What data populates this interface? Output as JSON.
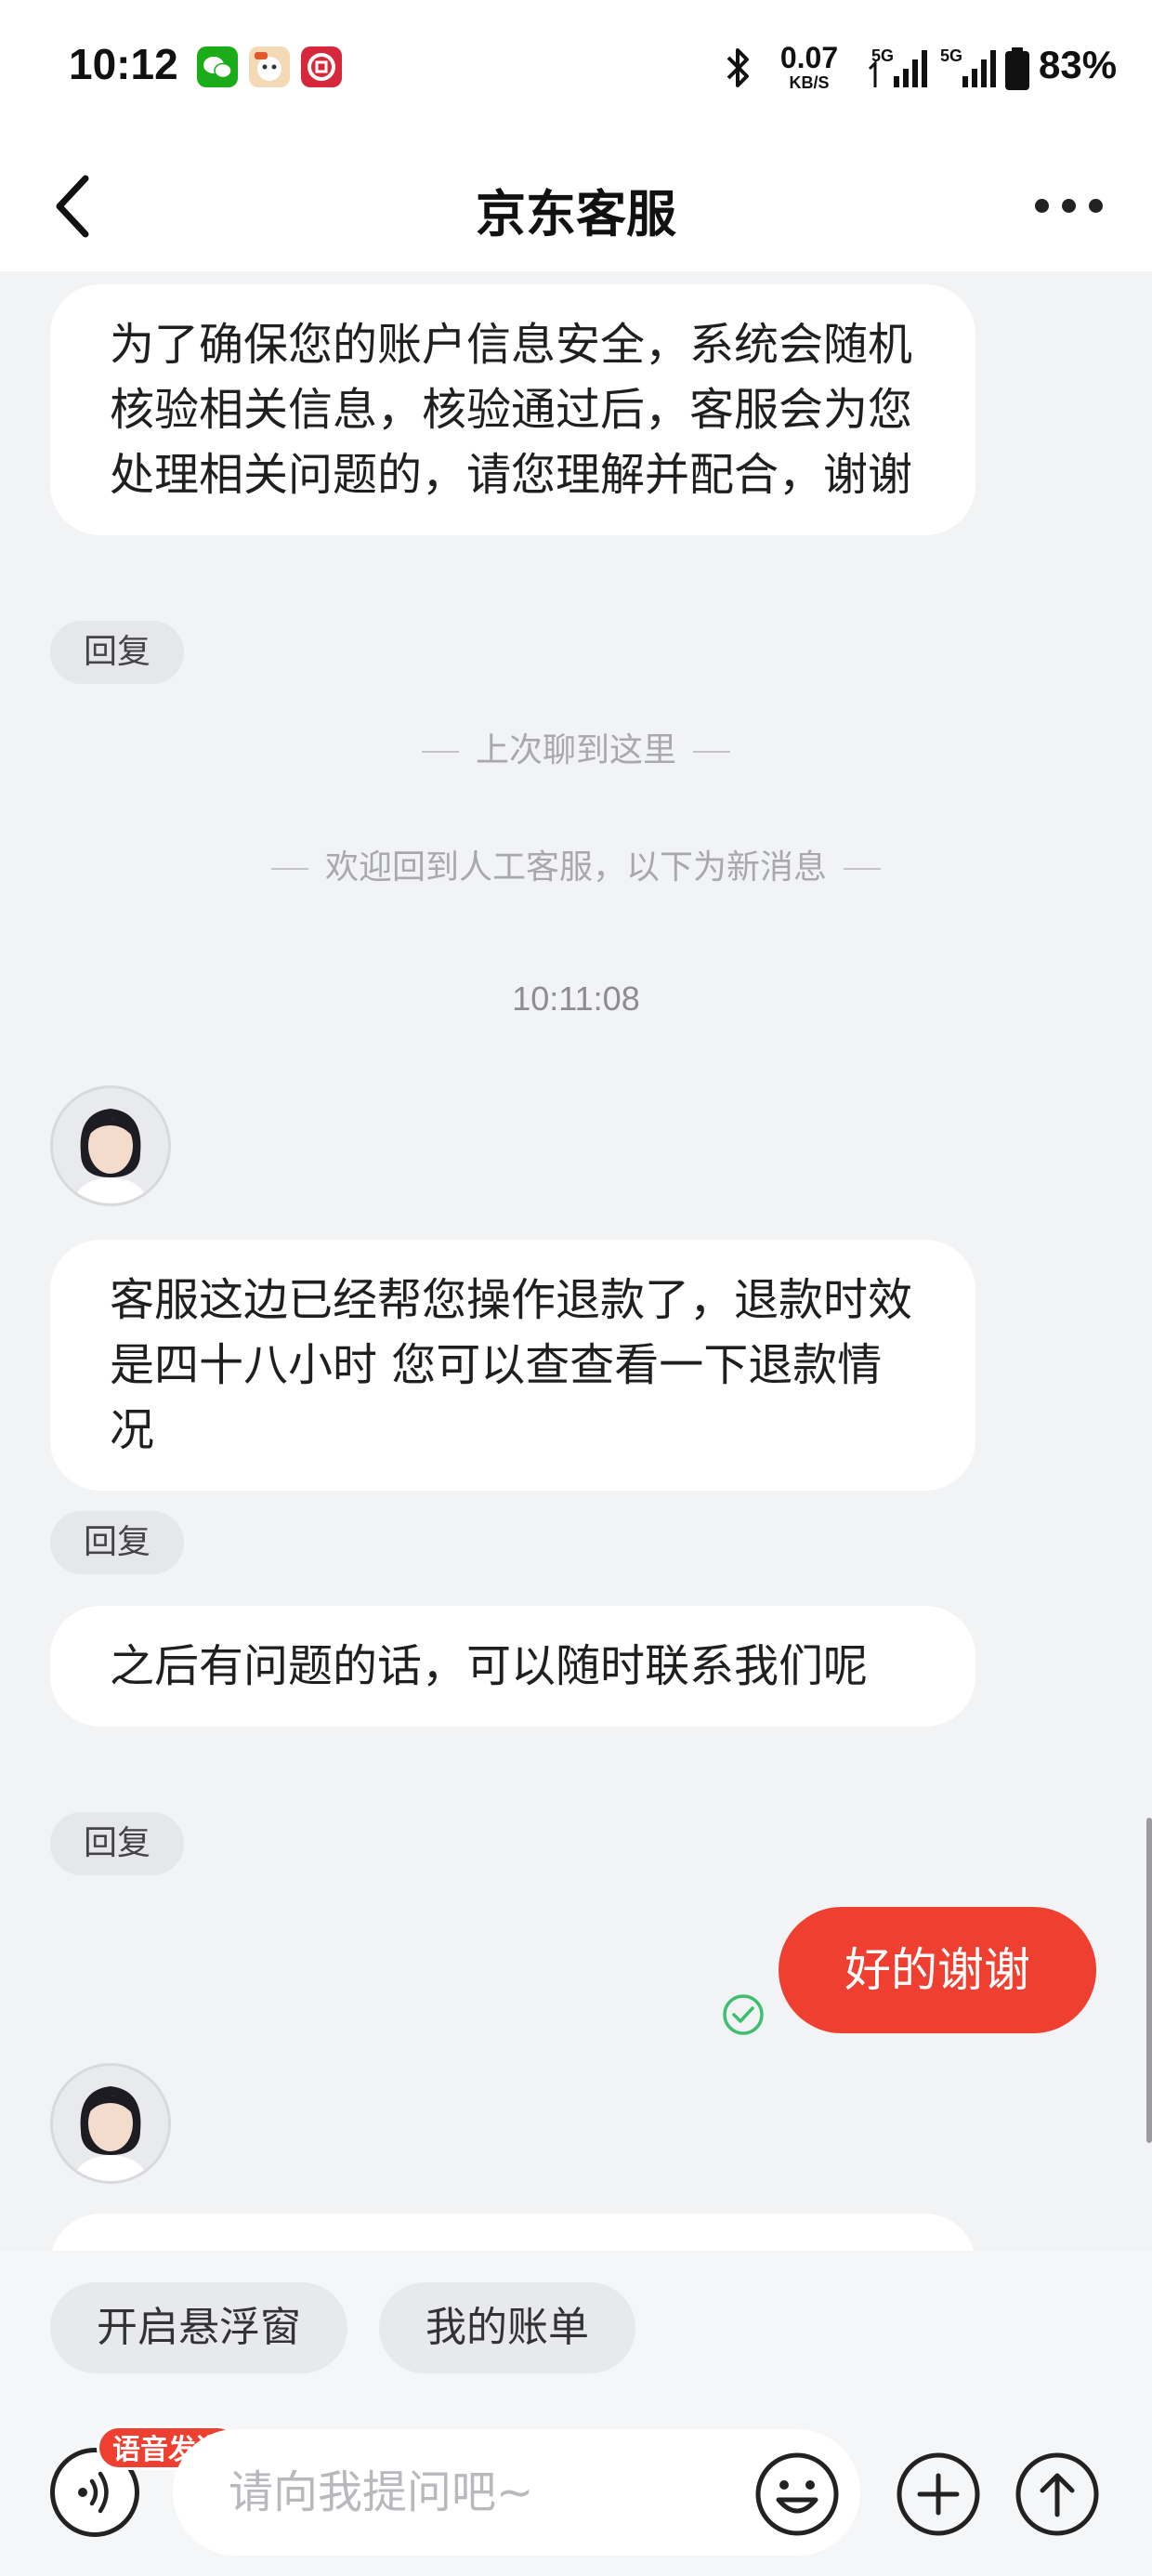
{
  "status_bar": {
    "time": "10:12",
    "net_speed_value": "0.07",
    "net_speed_unit": "KB/S",
    "signal1_label": "5G",
    "signal2_label": "5G",
    "battery": "83%"
  },
  "nav": {
    "title": "京东客服"
  },
  "chat": {
    "msg1": "为了确保您的账户信息安全，系统会随机核验相关信息，核验通过后，客服会为您处理相关问题的，请您理解并配合，谢谢",
    "reply_label": "回复",
    "divider_last": "上次聊到这里",
    "divider_welcome": "欢迎回到人工客服，以下为新消息",
    "timestamp": "10:11:08",
    "msg2": "客服这边已经帮您操作退款了，退款时效是四十八小时 您可以查查看一下退款情况",
    "msg3": "之后有问题的话，可以随时联系我们呢",
    "user_msg": "好的谢谢"
  },
  "quick_actions": {
    "float_window": "开启悬浮窗",
    "my_bill": "我的账单"
  },
  "input": {
    "voice_badge": "语音发送",
    "placeholder": "请向我提问吧~"
  },
  "colors": {
    "accent": "#ee3f30",
    "background": "#f2f3f5",
    "check": "#3cbf6e"
  }
}
